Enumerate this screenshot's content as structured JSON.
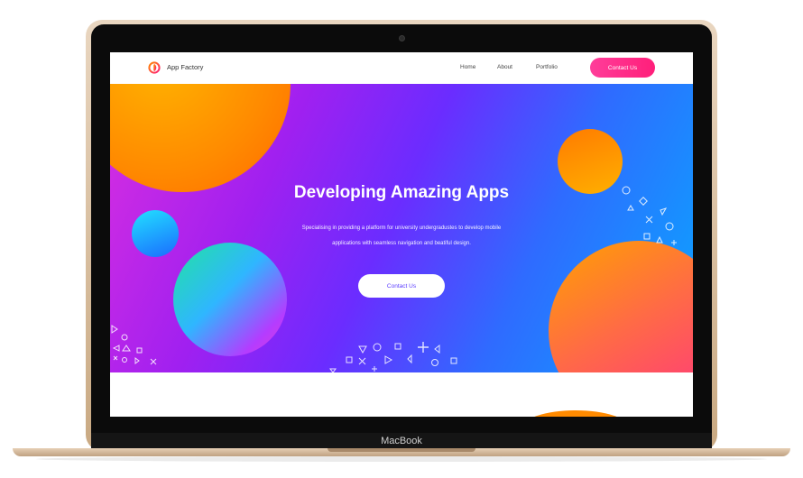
{
  "device": {
    "label": "MacBook",
    "frame_color": "#d9bd9c"
  },
  "nav": {
    "brand": "App Factory",
    "links": [
      "Home",
      "About",
      "Portfolio"
    ],
    "cta": "Contact Us",
    "cta_color": "#ff2f88"
  },
  "hero": {
    "title": "Developing Amazing Apps",
    "subtitle_line1": "Specialising in providing a platform for university undergradustes to develop mobile",
    "subtitle_line2": "applications with seamless navigation and beatiful design.",
    "button": "Contact Us",
    "gradient": [
      "#d92ee0",
      "#6b2cff",
      "#0aa6ff"
    ]
  }
}
